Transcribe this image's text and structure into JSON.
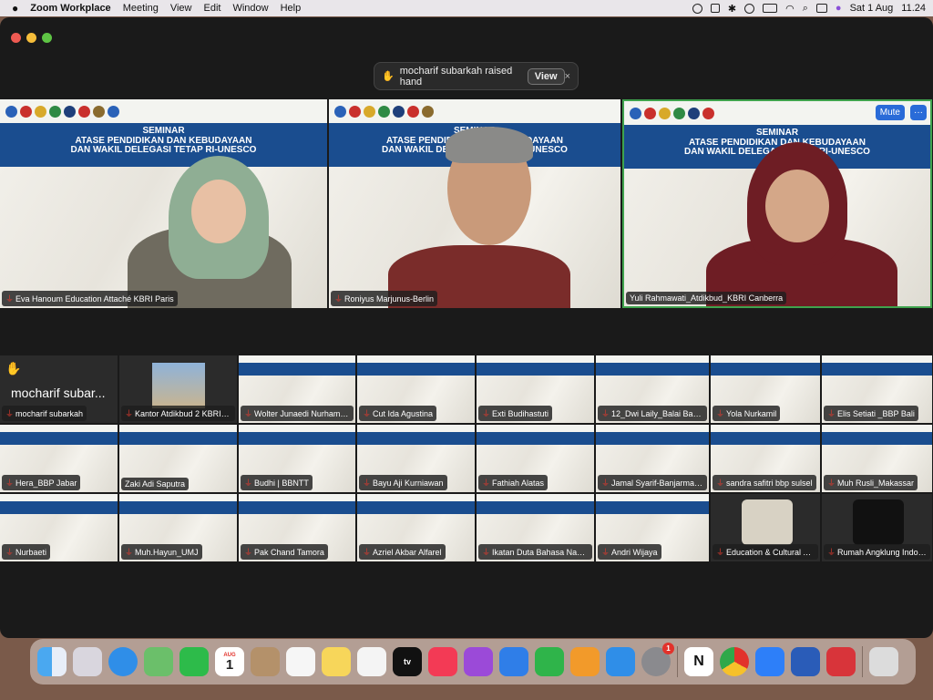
{
  "menubar": {
    "app": "Zoom Workplace",
    "items": [
      "Meeting",
      "View",
      "Edit",
      "Window",
      "Help"
    ],
    "date": "Sat 1 Aug",
    "time": "11.24"
  },
  "toast": {
    "message": "mocharif subarkah raised hand",
    "view": "View",
    "close": "×"
  },
  "banner": {
    "line1": "SEMINAR",
    "line2": "ATASE PENDIDIKAN DAN KEBUDAYAAN",
    "line3": "DAN WAKIL DELEGASI TETAP RI-UNESCO"
  },
  "speakers": [
    {
      "name": "Eva Hanoum Education Attaché KBRI Paris"
    },
    {
      "name": "Roniyus Marjunus-Berlin"
    },
    {
      "name": "Yuli Rahmawati_Atdikbud_KBRI Canberra",
      "mute": "Mute",
      "more": "···"
    }
  ],
  "gallery": {
    "raised_hand_name": "mocharif subar...",
    "row1": [
      "mocharif subarkah",
      "Kantor Atdikbud 2 KBRI P...",
      "Wolter Junaedi Nurhamidi...",
      "Cut Ida Agustina",
      "Exti Budihastuti",
      "12_Dwi Laily_Balai Bahas...",
      "Yola Nurkamil",
      "Elis Setiati _BBP Bali"
    ],
    "row2": [
      "Hera_BBP Jabar",
      "Zaki Adi Saputra",
      "Budhi | BBNTT",
      "Bayu Aji Kurniawan",
      "Fathiah Alatas",
      "Jamal Syarif-Banjarmasin",
      "sandra safitri bbp sulsel",
      "Muh Rusli_Makassar"
    ],
    "row3": [
      "Nurbaeti",
      "Muh.Hayun_UMJ",
      "Pak Chand Tamora",
      "Azriel Akbar Alfarel",
      "Ikatan Duta Bahasa Nasio...",
      "Andri Wijaya",
      "Education & Cultural Atta...",
      "Rumah Angklung Indonesia"
    ]
  },
  "dock": {
    "calendar_month": "AUG",
    "calendar_day": "1",
    "settings_badge": "1",
    "tv_label": "tv"
  }
}
